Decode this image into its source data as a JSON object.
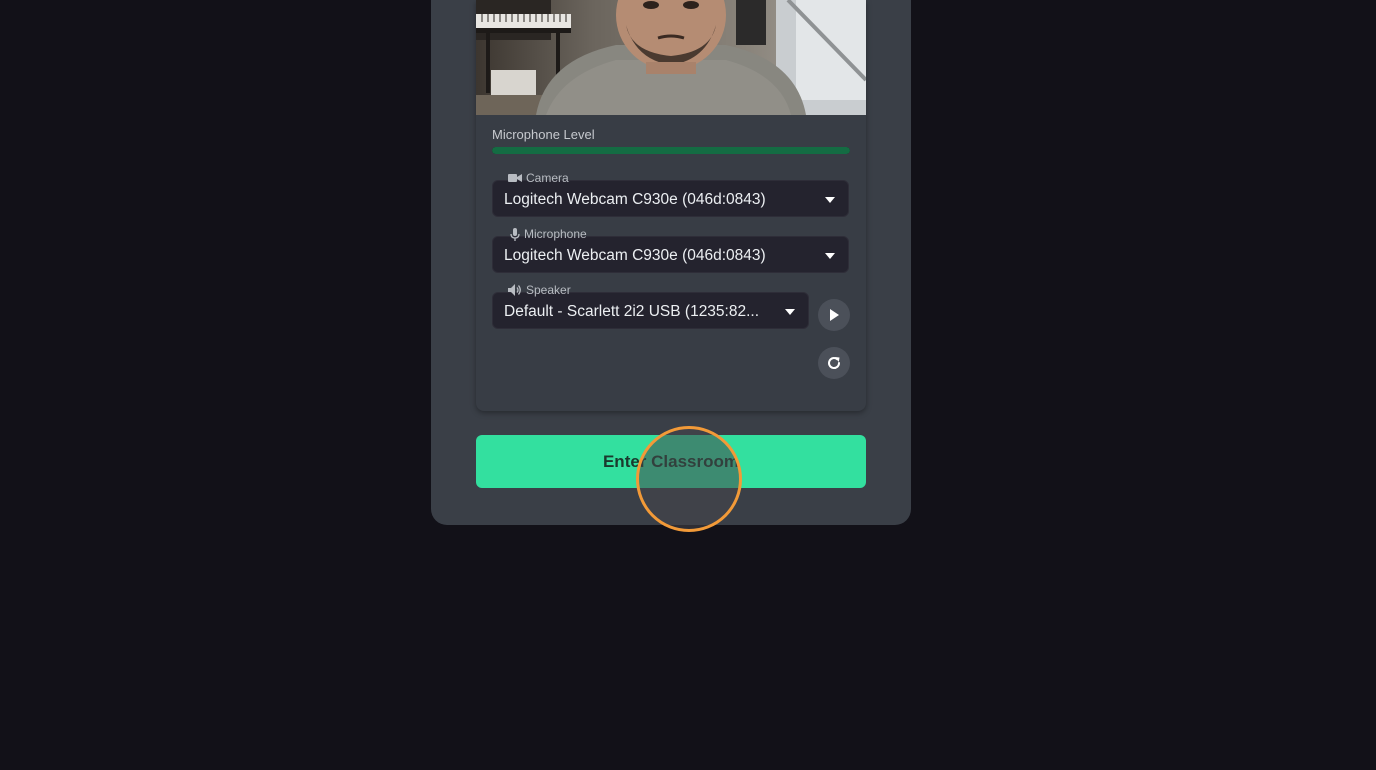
{
  "video_preview": {
    "icon": "webcam-person-image"
  },
  "microphone_level": {
    "label": "Microphone Level",
    "level_percent": 100,
    "color": "#146c43"
  },
  "devices": {
    "camera": {
      "label": "Camera",
      "icon": "camera-icon",
      "value": "Logitech Webcam C930e (046d:0843)"
    },
    "microphone": {
      "label": "Microphone",
      "icon": "microphone-icon",
      "value": "Logitech Webcam C930e (046d:0843)"
    },
    "speaker": {
      "label": "Speaker",
      "icon": "speaker-icon",
      "value": "Default - Scarlett 2i2 USB (1235:82..."
    }
  },
  "buttons": {
    "play_icon": "play-icon",
    "refresh_icon": "refresh-icon",
    "enter_label": "Enter Classroom"
  },
  "colors": {
    "background": "#121118",
    "card": "#3a3f47",
    "accent": "#33e09f",
    "click_ring": "#f29a38"
  }
}
